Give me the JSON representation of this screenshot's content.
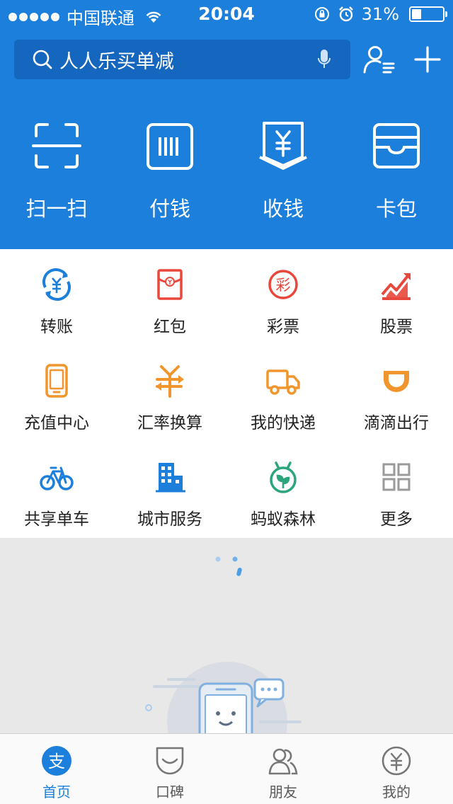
{
  "status_bar": {
    "carrier": "中国联通",
    "time": "20:04",
    "battery_text": "31%",
    "battery_level": 0.31
  },
  "search": {
    "placeholder": "人人乐买单减"
  },
  "quick_actions": [
    {
      "label": "扫一扫",
      "icon": "scan-icon"
    },
    {
      "label": "付钱",
      "icon": "barcode-pay-icon"
    },
    {
      "label": "收钱",
      "icon": "receive-money-icon"
    },
    {
      "label": "卡包",
      "icon": "card-wallet-icon"
    }
  ],
  "services": [
    {
      "label": "转账",
      "icon": "transfer-icon",
      "color": "#1c7fdb"
    },
    {
      "label": "红包",
      "icon": "red-envelope-icon",
      "color": "#e8473c"
    },
    {
      "label": "彩票",
      "icon": "lottery-icon",
      "color": "#e8473c"
    },
    {
      "label": "股票",
      "icon": "stock-icon",
      "color": "#e8473c"
    },
    {
      "label": "充值中心",
      "icon": "phone-recharge-icon",
      "color": "#f0962c"
    },
    {
      "label": "汇率换算",
      "icon": "exchange-rate-icon",
      "color": "#f0962c"
    },
    {
      "label": "我的快递",
      "icon": "delivery-truck-icon",
      "color": "#f0962c"
    },
    {
      "label": "滴滴出行",
      "icon": "didi-icon",
      "color": "#f0962c"
    },
    {
      "label": "共享单车",
      "icon": "bicycle-icon",
      "color": "#1c7fdb"
    },
    {
      "label": "城市服务",
      "icon": "city-building-icon",
      "color": "#1c7fdb"
    },
    {
      "label": "蚂蚁森林",
      "icon": "ant-forest-icon",
      "color": "#2aa57c"
    },
    {
      "label": "更多",
      "icon": "more-grid-icon",
      "color": "#9a9a9a"
    }
  ],
  "tabs": [
    {
      "label": "首页",
      "icon": "alipay-home-icon",
      "active": true
    },
    {
      "label": "口碑",
      "icon": "koubei-icon",
      "active": false
    },
    {
      "label": "朋友",
      "icon": "friends-icon",
      "active": false
    },
    {
      "label": "我的",
      "icon": "my-yuan-icon",
      "active": false
    }
  ],
  "colors": {
    "primary": "#1c7fdb",
    "search_bg": "#1566bf",
    "orange": "#f0962c",
    "red": "#e8473c",
    "green": "#2aa57c"
  }
}
